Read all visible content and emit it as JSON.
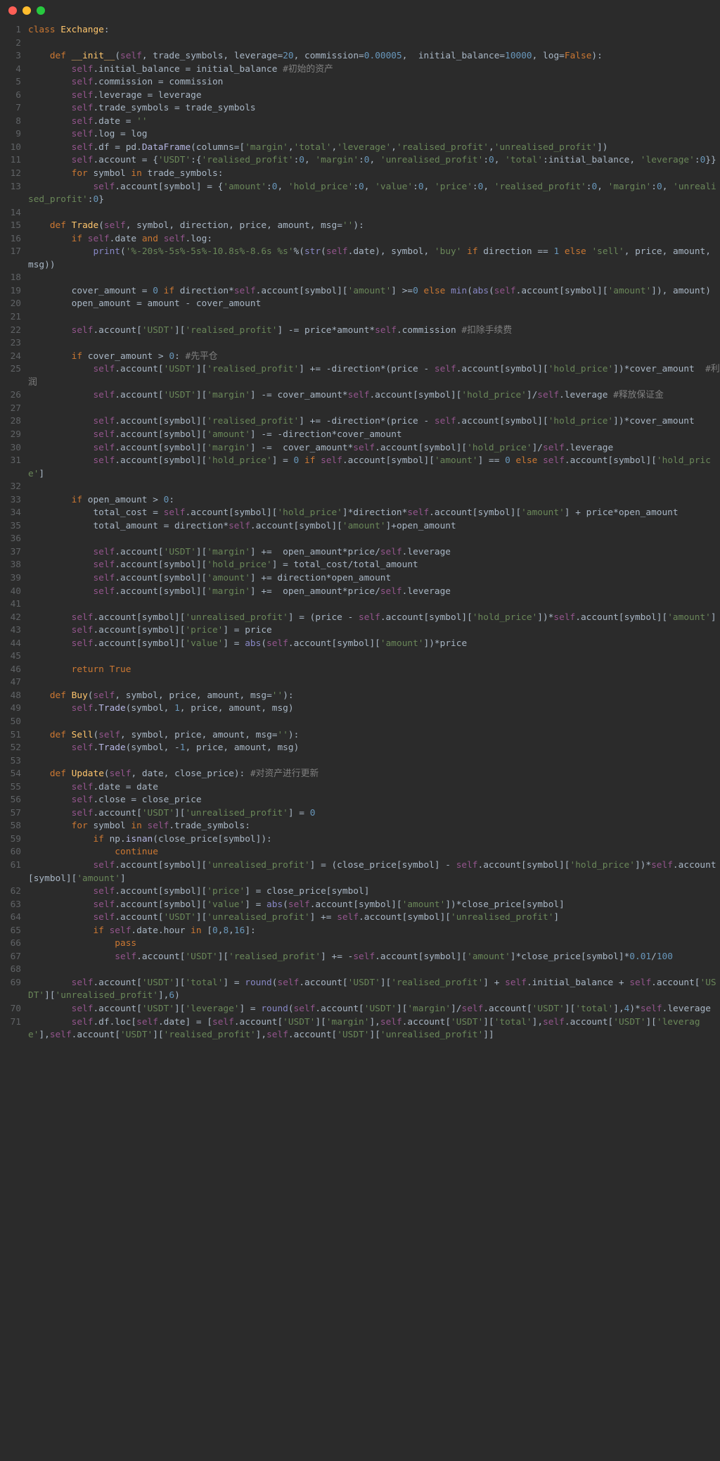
{
  "window": {
    "dots": [
      "red",
      "yellow",
      "green"
    ]
  },
  "chart_data": null,
  "lines": [
    {
      "n": 1,
      "html": "<span class='kw'>class</span> <span class='fn'>Exchange</span>:"
    },
    {
      "n": 2,
      "html": ""
    },
    {
      "n": 3,
      "html": "    <span class='kw-def'>def</span> <span class='fn'>__init__</span>(<span class='kw-self'>self</span>, trade_symbols, leverage=<span class='num'>20</span>, commission=<span class='num'>0.00005</span>,  initial_balance=<span class='num'>10000</span>, log=<span class='bool'>False</span>):"
    },
    {
      "n": 4,
      "html": "        <span class='kw-self'>self</span>.initial_balance = initial_balance <span class='cm'>#初始的资产</span>"
    },
    {
      "n": 5,
      "html": "        <span class='kw-self'>self</span>.commission = commission"
    },
    {
      "n": 6,
      "html": "        <span class='kw-self'>self</span>.leverage = leverage"
    },
    {
      "n": 7,
      "html": "        <span class='kw-self'>self</span>.trade_symbols = trade_symbols"
    },
    {
      "n": 8,
      "html": "        <span class='kw-self'>self</span>.date = <span class='str'>''</span>"
    },
    {
      "n": 9,
      "html": "        <span class='kw-self'>self</span>.log = log"
    },
    {
      "n": 10,
      "html": "        <span class='kw-self'>self</span>.df = pd.<span class='fn-call'>DataFrame</span>(columns=[<span class='str'>'margin'</span>,<span class='str'>'total'</span>,<span class='str'>'leverage'</span>,<span class='str'>'realised_profit'</span>,<span class='str'>'unrealised_profit'</span>])"
    },
    {
      "n": 11,
      "html": "        <span class='kw-self'>self</span>.account = {<span class='str'>'USDT'</span>:{<span class='str'>'realised_profit'</span>:<span class='num'>0</span>, <span class='str'>'margin'</span>:<span class='num'>0</span>, <span class='str'>'unrealised_profit'</span>:<span class='num'>0</span>, <span class='str'>'total'</span>:initial_balance, <span class='str'>'leverage'</span>:<span class='num'>0</span>}}"
    },
    {
      "n": 12,
      "html": "        <span class='kw'>for</span> symbol <span class='kw'>in</span> trade_symbols:"
    },
    {
      "n": 13,
      "html": "            <span class='kw-self'>self</span>.account[symbol] = {<span class='str'>'amount'</span>:<span class='num'>0</span>, <span class='str'>'hold_price'</span>:<span class='num'>0</span>, <span class='str'>'value'</span>:<span class='num'>0</span>, <span class='str'>'price'</span>:<span class='num'>0</span>, <span class='str'>'realised_profit'</span>:<span class='num'>0</span>, <span class='str'>'margin'</span>:<span class='num'>0</span>, <span class='str'>'unrealised_profit'</span>:<span class='num'>0</span>}"
    },
    {
      "n": 14,
      "html": ""
    },
    {
      "n": 15,
      "html": "    <span class='kw-def'>def</span> <span class='fn'>Trade</span>(<span class='kw-self'>self</span>, symbol, direction, price, amount, msg=<span class='str'>''</span>):"
    },
    {
      "n": 16,
      "html": "        <span class='kw'>if</span> <span class='kw-self'>self</span>.date <span class='kw'>and</span> <span class='kw-self'>self</span>.log:"
    },
    {
      "n": 17,
      "html": "            <span class='builtin'>print</span>(<span class='str'>'%-20s%-5s%-5s%-10.8s%-8.6s %s'</span>%(<span class='builtin'>str</span>(<span class='kw-self'>self</span>.date), symbol, <span class='str'>'buy'</span> <span class='kw'>if</span> direction == <span class='num'>1</span> <span class='kw'>else</span> <span class='str'>'sell'</span>, price, amount, msg))"
    },
    {
      "n": 18,
      "html": ""
    },
    {
      "n": 19,
      "html": "        cover_amount = <span class='num'>0</span> <span class='kw'>if</span> direction*<span class='kw-self'>self</span>.account[symbol][<span class='str'>'amount'</span>] &gt;=<span class='num'>0</span> <span class='kw'>else</span> <span class='builtin'>min</span>(<span class='builtin'>abs</span>(<span class='kw-self'>self</span>.account[symbol][<span class='str'>'amount'</span>]), amount)"
    },
    {
      "n": 20,
      "html": "        open_amount = amount - cover_amount"
    },
    {
      "n": 21,
      "html": ""
    },
    {
      "n": 22,
      "html": "        <span class='kw-self'>self</span>.account[<span class='str'>'USDT'</span>][<span class='str'>'realised_profit'</span>] -= price*amount*<span class='kw-self'>self</span>.commission <span class='cm'>#扣除手续费</span>"
    },
    {
      "n": 23,
      "html": ""
    },
    {
      "n": 24,
      "html": "        <span class='kw'>if</span> cover_amount &gt; <span class='num'>0</span>: <span class='cm'>#先平仓</span>"
    },
    {
      "n": 25,
      "html": "            <span class='kw-self'>self</span>.account[<span class='str'>'USDT'</span>][<span class='str'>'realised_profit'</span>] += -direction*(price - <span class='kw-self'>self</span>.account[symbol][<span class='str'>'hold_price'</span>])*cover_amount  <span class='cm'>#利润</span>"
    },
    {
      "n": 26,
      "html": "            <span class='kw-self'>self</span>.account[<span class='str'>'USDT'</span>][<span class='str'>'margin'</span>] -= cover_amount*<span class='kw-self'>self</span>.account[symbol][<span class='str'>'hold_price'</span>]/<span class='kw-self'>self</span>.leverage <span class='cm'>#释放保证金</span>"
    },
    {
      "n": 27,
      "html": ""
    },
    {
      "n": 28,
      "html": "            <span class='kw-self'>self</span>.account[symbol][<span class='str'>'realised_profit'</span>] += -direction*(price - <span class='kw-self'>self</span>.account[symbol][<span class='str'>'hold_price'</span>])*cover_amount"
    },
    {
      "n": 29,
      "html": "            <span class='kw-self'>self</span>.account[symbol][<span class='str'>'amount'</span>] -= -direction*cover_amount"
    },
    {
      "n": 30,
      "html": "            <span class='kw-self'>self</span>.account[symbol][<span class='str'>'margin'</span>] -=  cover_amount*<span class='kw-self'>self</span>.account[symbol][<span class='str'>'hold_price'</span>]/<span class='kw-self'>self</span>.leverage"
    },
    {
      "n": 31,
      "html": "            <span class='kw-self'>self</span>.account[symbol][<span class='str'>'hold_price'</span>] = <span class='num'>0</span> <span class='kw'>if</span> <span class='kw-self'>self</span>.account[symbol][<span class='str'>'amount'</span>] == <span class='num'>0</span> <span class='kw'>else</span> <span class='kw-self'>self</span>.account[symbol][<span class='str'>'hold_price'</span>]"
    },
    {
      "n": 32,
      "html": ""
    },
    {
      "n": 33,
      "html": "        <span class='kw'>if</span> open_amount &gt; <span class='num'>0</span>:"
    },
    {
      "n": 34,
      "html": "            total_cost = <span class='kw-self'>self</span>.account[symbol][<span class='str'>'hold_price'</span>]*direction*<span class='kw-self'>self</span>.account[symbol][<span class='str'>'amount'</span>] + price*open_amount"
    },
    {
      "n": 35,
      "html": "            total_amount = direction*<span class='kw-self'>self</span>.account[symbol][<span class='str'>'amount'</span>]+open_amount"
    },
    {
      "n": 36,
      "html": ""
    },
    {
      "n": 37,
      "html": "            <span class='kw-self'>self</span>.account[<span class='str'>'USDT'</span>][<span class='str'>'margin'</span>] +=  open_amount*price/<span class='kw-self'>self</span>.leverage"
    },
    {
      "n": 38,
      "html": "            <span class='kw-self'>self</span>.account[symbol][<span class='str'>'hold_price'</span>] = total_cost/total_amount"
    },
    {
      "n": 39,
      "html": "            <span class='kw-self'>self</span>.account[symbol][<span class='str'>'amount'</span>] += direction*open_amount"
    },
    {
      "n": 40,
      "html": "            <span class='kw-self'>self</span>.account[symbol][<span class='str'>'margin'</span>] +=  open_amount*price/<span class='kw-self'>self</span>.leverage"
    },
    {
      "n": 41,
      "html": ""
    },
    {
      "n": 42,
      "html": "        <span class='kw-self'>self</span>.account[symbol][<span class='str'>'unrealised_profit'</span>] = (price - <span class='kw-self'>self</span>.account[symbol][<span class='str'>'hold_price'</span>])*<span class='kw-self'>self</span>.account[symbol][<span class='str'>'amount'</span>]"
    },
    {
      "n": 43,
      "html": "        <span class='kw-self'>self</span>.account[symbol][<span class='str'>'price'</span>] = price"
    },
    {
      "n": 44,
      "html": "        <span class='kw-self'>self</span>.account[symbol][<span class='str'>'value'</span>] = <span class='builtin'>abs</span>(<span class='kw-self'>self</span>.account[symbol][<span class='str'>'amount'</span>])*price"
    },
    {
      "n": 45,
      "html": ""
    },
    {
      "n": 46,
      "html": "        <span class='kw'>return</span> <span class='bool'>True</span>"
    },
    {
      "n": 47,
      "html": ""
    },
    {
      "n": 48,
      "html": "    <span class='kw-def'>def</span> <span class='fn'>Buy</span>(<span class='kw-self'>self</span>, symbol, price, amount, msg=<span class='str'>''</span>):"
    },
    {
      "n": 49,
      "html": "        <span class='kw-self'>self</span>.<span class='fn-call'>Trade</span>(symbol, <span class='num'>1</span>, price, amount, msg)"
    },
    {
      "n": 50,
      "html": ""
    },
    {
      "n": 51,
      "html": "    <span class='kw-def'>def</span> <span class='fn'>Sell</span>(<span class='kw-self'>self</span>, symbol, price, amount, msg=<span class='str'>''</span>):"
    },
    {
      "n": 52,
      "html": "        <span class='kw-self'>self</span>.<span class='fn-call'>Trade</span>(symbol, -<span class='num'>1</span>, price, amount, msg)"
    },
    {
      "n": 53,
      "html": ""
    },
    {
      "n": 54,
      "html": "    <span class='kw-def'>def</span> <span class='fn'>Update</span>(<span class='kw-self'>self</span>, date, close_price): <span class='cm'>#对资产进行更新</span>"
    },
    {
      "n": 55,
      "html": "        <span class='kw-self'>self</span>.date = date"
    },
    {
      "n": 56,
      "html": "        <span class='kw-self'>self</span>.close = close_price"
    },
    {
      "n": 57,
      "html": "        <span class='kw-self'>self</span>.account[<span class='str'>'USDT'</span>][<span class='str'>'unrealised_profit'</span>] = <span class='num'>0</span>"
    },
    {
      "n": 58,
      "html": "        <span class='kw'>for</span> symbol <span class='kw'>in</span> <span class='kw-self'>self</span>.trade_symbols:"
    },
    {
      "n": 59,
      "html": "            <span class='kw'>if</span> np.<span class='fn-call'>isnan</span>(close_price[symbol]):"
    },
    {
      "n": 60,
      "html": "                <span class='kw'>continue</span>"
    },
    {
      "n": 61,
      "html": "            <span class='kw-self'>self</span>.account[symbol][<span class='str'>'unrealised_profit'</span>] = (close_price[symbol] - <span class='kw-self'>self</span>.account[symbol][<span class='str'>'hold_price'</span>])*<span class='kw-self'>self</span>.account[symbol][<span class='str'>'amount'</span>]"
    },
    {
      "n": 62,
      "html": "            <span class='kw-self'>self</span>.account[symbol][<span class='str'>'price'</span>] = close_price[symbol]"
    },
    {
      "n": 63,
      "html": "            <span class='kw-self'>self</span>.account[symbol][<span class='str'>'value'</span>] = <span class='builtin'>abs</span>(<span class='kw-self'>self</span>.account[symbol][<span class='str'>'amount'</span>])*close_price[symbol]"
    },
    {
      "n": 64,
      "html": "            <span class='kw-self'>self</span>.account[<span class='str'>'USDT'</span>][<span class='str'>'unrealised_profit'</span>] += <span class='kw-self'>self</span>.account[symbol][<span class='str'>'unrealised_profit'</span>]"
    },
    {
      "n": 65,
      "html": "            <span class='kw'>if</span> <span class='kw-self'>self</span>.date.hour <span class='kw'>in</span> [<span class='num'>0</span>,<span class='num'>8</span>,<span class='num'>16</span>]:"
    },
    {
      "n": 66,
      "html": "                <span class='kw'>pass</span>"
    },
    {
      "n": 67,
      "html": "                <span class='kw-self'>self</span>.account[<span class='str'>'USDT'</span>][<span class='str'>'realised_profit'</span>] += -<span class='kw-self'>self</span>.account[symbol][<span class='str'>'amount'</span>]*close_price[symbol]*<span class='num'>0.01</span>/<span class='num'>100</span>"
    },
    {
      "n": 68,
      "html": ""
    },
    {
      "n": 69,
      "html": "        <span class='kw-self'>self</span>.account[<span class='str'>'USDT'</span>][<span class='str'>'total'</span>] = <span class='builtin'>round</span>(<span class='kw-self'>self</span>.account[<span class='str'>'USDT'</span>][<span class='str'>'realised_profit'</span>] + <span class='kw-self'>self</span>.initial_balance + <span class='kw-self'>self</span>.account[<span class='str'>'USDT'</span>][<span class='str'>'unrealised_profit'</span>],<span class='num'>6</span>)"
    },
    {
      "n": 70,
      "html": "        <span class='kw-self'>self</span>.account[<span class='str'>'USDT'</span>][<span class='str'>'leverage'</span>] = <span class='builtin'>round</span>(<span class='kw-self'>self</span>.account[<span class='str'>'USDT'</span>][<span class='str'>'margin'</span>]/<span class='kw-self'>self</span>.account[<span class='str'>'USDT'</span>][<span class='str'>'total'</span>],<span class='num'>4</span>)*<span class='kw-self'>self</span>.leverage"
    },
    {
      "n": 71,
      "html": "        <span class='kw-self'>self</span>.df.loc[<span class='kw-self'>self</span>.date] = [<span class='kw-self'>self</span>.account[<span class='str'>'USDT'</span>][<span class='str'>'margin'</span>],<span class='kw-self'>self</span>.account[<span class='str'>'USDT'</span>][<span class='str'>'total'</span>],<span class='kw-self'>self</span>.account[<span class='str'>'USDT'</span>][<span class='str'>'leverage'</span>],<span class='kw-self'>self</span>.account[<span class='str'>'USDT'</span>][<span class='str'>'realised_profit'</span>],<span class='kw-self'>self</span>.account[<span class='str'>'USDT'</span>][<span class='str'>'unrealised_profit'</span>]]"
    }
  ]
}
